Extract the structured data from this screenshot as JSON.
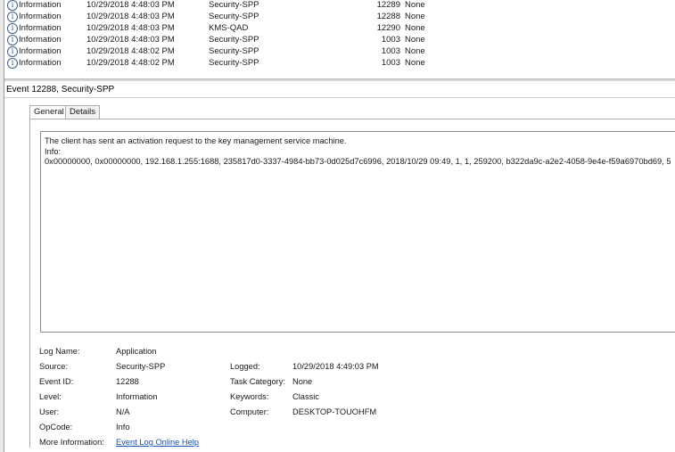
{
  "event_list": {
    "rows": [
      {
        "level": "Information",
        "date": "10/29/2018 4:48:03 PM",
        "source": "Security-SPP",
        "event_id": "12289",
        "task": "None"
      },
      {
        "level": "Information",
        "date": "10/29/2018 4:48:03 PM",
        "source": "Security-SPP",
        "event_id": "12288",
        "task": "None"
      },
      {
        "level": "Information",
        "date": "10/29/2018 4:48:03 PM",
        "source": "KMS-QAD",
        "event_id": "12290",
        "task": "None"
      },
      {
        "level": "Information",
        "date": "10/29/2018 4:48:03 PM",
        "source": "Security-SPP",
        "event_id": "1003",
        "task": "None"
      },
      {
        "level": "Information",
        "date": "10/29/2018 4:48:02 PM",
        "source": "Security-SPP",
        "event_id": "1003",
        "task": "None"
      },
      {
        "level": "Information",
        "date": "10/29/2018 4:48:02 PM",
        "source": "Security-SPP",
        "event_id": "1003",
        "task": "None"
      }
    ],
    "info_icon_glyph": "i",
    "info_icon": "information-icon"
  },
  "detail": {
    "title": "Event 12288, Security-SPP",
    "tabs": [
      "General",
      "Details"
    ],
    "active_tab": "General",
    "description": {
      "line1": "The client has sent an activation request to the key management service machine.",
      "line2": "Info:",
      "line3": "0x00000000, 0x00000000, 192.168.1.255:1688, 235817d0-3337-4984-bb73-0d025d7c6996, 2018/10/29 09:49, 1, 1, 259200, b322da9c-a2e2-4058-9e4e-f59a6970bd69, 5"
    },
    "properties": {
      "log_name_label": "Log Name:",
      "log_name": "Application",
      "source_label": "Source:",
      "source": "Security-SPP",
      "logged_label": "Logged:",
      "logged": "10/29/2018 4:49:03 PM",
      "event_id_label": "Event ID:",
      "event_id": "12288",
      "task_category_label": "Task Category:",
      "task_category": "None",
      "level_label": "Level:",
      "level": "Information",
      "keywords_label": "Keywords:",
      "keywords": "Classic",
      "user_label": "User:",
      "user": "N/A",
      "computer_label": "Computer:",
      "computer": "DESKTOP-TOUOHFM",
      "opcode_label": "OpCode:",
      "opcode": "Info",
      "more_info_label": "More Information:",
      "more_info_link": "Event Log Online Help"
    }
  },
  "colors": {
    "link": "#1a4fb0",
    "border": "#acacac",
    "icon": "#2d4f7e"
  }
}
